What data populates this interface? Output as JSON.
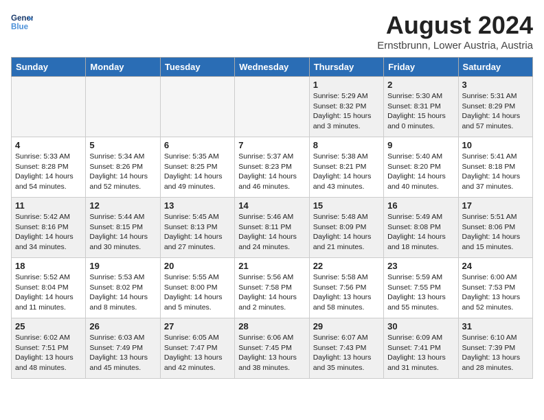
{
  "header": {
    "logo_line1": "General",
    "logo_line2": "Blue",
    "month": "August 2024",
    "location": "Ernstbrunn, Lower Austria, Austria"
  },
  "weekdays": [
    "Sunday",
    "Monday",
    "Tuesday",
    "Wednesday",
    "Thursday",
    "Friday",
    "Saturday"
  ],
  "weeks": [
    [
      {
        "day": "",
        "info": ""
      },
      {
        "day": "",
        "info": ""
      },
      {
        "day": "",
        "info": ""
      },
      {
        "day": "",
        "info": ""
      },
      {
        "day": "1",
        "info": "Sunrise: 5:29 AM\nSunset: 8:32 PM\nDaylight: 15 hours\nand 3 minutes."
      },
      {
        "day": "2",
        "info": "Sunrise: 5:30 AM\nSunset: 8:31 PM\nDaylight: 15 hours\nand 0 minutes."
      },
      {
        "day": "3",
        "info": "Sunrise: 5:31 AM\nSunset: 8:29 PM\nDaylight: 14 hours\nand 57 minutes."
      }
    ],
    [
      {
        "day": "4",
        "info": "Sunrise: 5:33 AM\nSunset: 8:28 PM\nDaylight: 14 hours\nand 54 minutes."
      },
      {
        "day": "5",
        "info": "Sunrise: 5:34 AM\nSunset: 8:26 PM\nDaylight: 14 hours\nand 52 minutes."
      },
      {
        "day": "6",
        "info": "Sunrise: 5:35 AM\nSunset: 8:25 PM\nDaylight: 14 hours\nand 49 minutes."
      },
      {
        "day": "7",
        "info": "Sunrise: 5:37 AM\nSunset: 8:23 PM\nDaylight: 14 hours\nand 46 minutes."
      },
      {
        "day": "8",
        "info": "Sunrise: 5:38 AM\nSunset: 8:21 PM\nDaylight: 14 hours\nand 43 minutes."
      },
      {
        "day": "9",
        "info": "Sunrise: 5:40 AM\nSunset: 8:20 PM\nDaylight: 14 hours\nand 40 minutes."
      },
      {
        "day": "10",
        "info": "Sunrise: 5:41 AM\nSunset: 8:18 PM\nDaylight: 14 hours\nand 37 minutes."
      }
    ],
    [
      {
        "day": "11",
        "info": "Sunrise: 5:42 AM\nSunset: 8:16 PM\nDaylight: 14 hours\nand 34 minutes."
      },
      {
        "day": "12",
        "info": "Sunrise: 5:44 AM\nSunset: 8:15 PM\nDaylight: 14 hours\nand 30 minutes."
      },
      {
        "day": "13",
        "info": "Sunrise: 5:45 AM\nSunset: 8:13 PM\nDaylight: 14 hours\nand 27 minutes."
      },
      {
        "day": "14",
        "info": "Sunrise: 5:46 AM\nSunset: 8:11 PM\nDaylight: 14 hours\nand 24 minutes."
      },
      {
        "day": "15",
        "info": "Sunrise: 5:48 AM\nSunset: 8:09 PM\nDaylight: 14 hours\nand 21 minutes."
      },
      {
        "day": "16",
        "info": "Sunrise: 5:49 AM\nSunset: 8:08 PM\nDaylight: 14 hours\nand 18 minutes."
      },
      {
        "day": "17",
        "info": "Sunrise: 5:51 AM\nSunset: 8:06 PM\nDaylight: 14 hours\nand 15 minutes."
      }
    ],
    [
      {
        "day": "18",
        "info": "Sunrise: 5:52 AM\nSunset: 8:04 PM\nDaylight: 14 hours\nand 11 minutes."
      },
      {
        "day": "19",
        "info": "Sunrise: 5:53 AM\nSunset: 8:02 PM\nDaylight: 14 hours\nand 8 minutes."
      },
      {
        "day": "20",
        "info": "Sunrise: 5:55 AM\nSunset: 8:00 PM\nDaylight: 14 hours\nand 5 minutes."
      },
      {
        "day": "21",
        "info": "Sunrise: 5:56 AM\nSunset: 7:58 PM\nDaylight: 14 hours\nand 2 minutes."
      },
      {
        "day": "22",
        "info": "Sunrise: 5:58 AM\nSunset: 7:56 PM\nDaylight: 13 hours\nand 58 minutes."
      },
      {
        "day": "23",
        "info": "Sunrise: 5:59 AM\nSunset: 7:55 PM\nDaylight: 13 hours\nand 55 minutes."
      },
      {
        "day": "24",
        "info": "Sunrise: 6:00 AM\nSunset: 7:53 PM\nDaylight: 13 hours\nand 52 minutes."
      }
    ],
    [
      {
        "day": "25",
        "info": "Sunrise: 6:02 AM\nSunset: 7:51 PM\nDaylight: 13 hours\nand 48 minutes."
      },
      {
        "day": "26",
        "info": "Sunrise: 6:03 AM\nSunset: 7:49 PM\nDaylight: 13 hours\nand 45 minutes."
      },
      {
        "day": "27",
        "info": "Sunrise: 6:05 AM\nSunset: 7:47 PM\nDaylight: 13 hours\nand 42 minutes."
      },
      {
        "day": "28",
        "info": "Sunrise: 6:06 AM\nSunset: 7:45 PM\nDaylight: 13 hours\nand 38 minutes."
      },
      {
        "day": "29",
        "info": "Sunrise: 6:07 AM\nSunset: 7:43 PM\nDaylight: 13 hours\nand 35 minutes."
      },
      {
        "day": "30",
        "info": "Sunrise: 6:09 AM\nSunset: 7:41 PM\nDaylight: 13 hours\nand 31 minutes."
      },
      {
        "day": "31",
        "info": "Sunrise: 6:10 AM\nSunset: 7:39 PM\nDaylight: 13 hours\nand 28 minutes."
      }
    ]
  ]
}
